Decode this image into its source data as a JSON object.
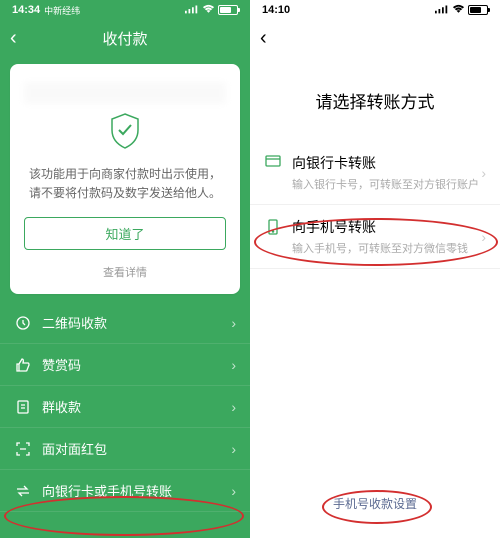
{
  "left": {
    "status": {
      "time": "14:34",
      "carrier": "中新经纬"
    },
    "header": {
      "title": "收付款"
    },
    "card": {
      "notice": "该功能用于向商家付款时出示使用，请不要将付款码及数字发送给他人。",
      "got_it": "知道了",
      "details": "查看详情"
    },
    "menu": [
      {
        "label": "二维码收款"
      },
      {
        "label": "赞赏码"
      },
      {
        "label": "群收款"
      },
      {
        "label": "面对面红包"
      },
      {
        "label": "向银行卡或手机号转账"
      }
    ]
  },
  "right": {
    "status": {
      "time": "14:10"
    },
    "title": "请选择转账方式",
    "options": [
      {
        "title": "向银行卡转账",
        "subtitle": "输入银行卡号，可转账至对方银行账户"
      },
      {
        "title": "向手机号转账",
        "subtitle": "输入手机号，可转账至对方微信零钱"
      }
    ],
    "bottom_link": "手机号收款设置"
  }
}
